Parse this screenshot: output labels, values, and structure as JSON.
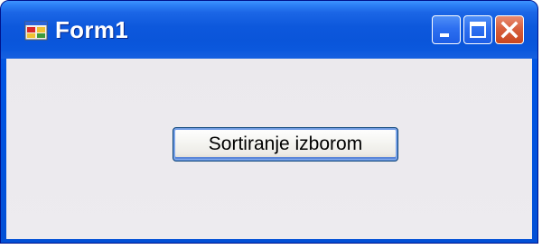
{
  "window": {
    "title": "Form1",
    "icon": "winforms-app-icon",
    "controls": {
      "minimize_icon": "minimize-icon",
      "maximize_icon": "maximize-icon",
      "close_icon": "close-icon"
    }
  },
  "main": {
    "button_label": "Sortiranje izborom"
  },
  "colors": {
    "titlebar": "#0a55da",
    "client_background": "#ebe9ed",
    "close_button": "#d8603e",
    "button_border": "#003c74"
  }
}
